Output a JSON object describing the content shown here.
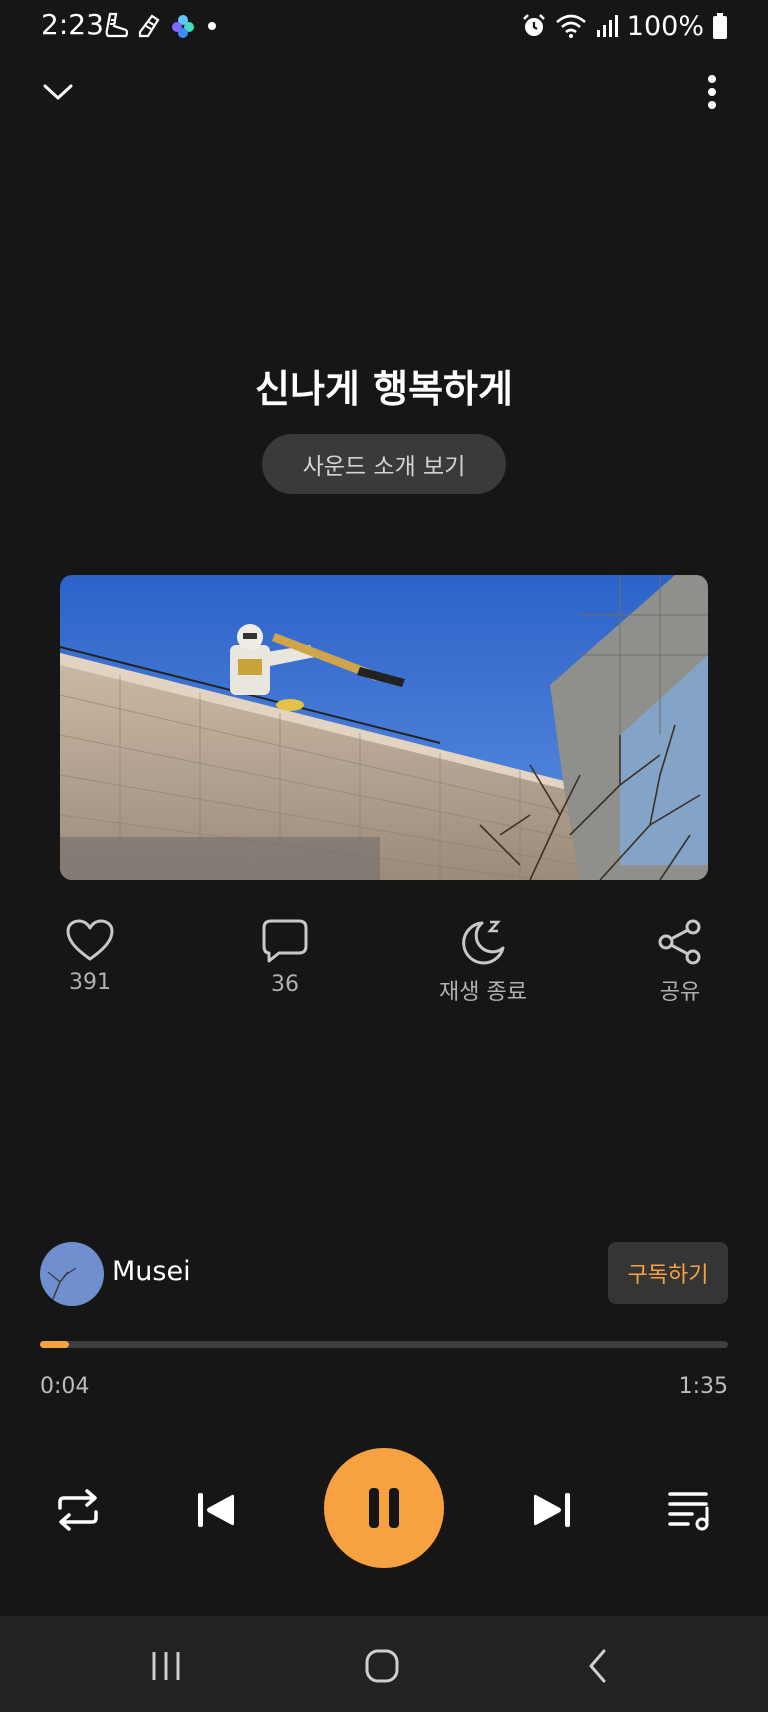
{
  "status_bar": {
    "time": "2:23",
    "battery": "100%",
    "left_icons": [
      "sneaker-icon",
      "sneaker-icon",
      "sparkle-app-icon",
      "dot-icon"
    ],
    "right_icons": [
      "alarm-icon",
      "wifi-icon",
      "signal-icon",
      "battery-icon"
    ]
  },
  "header": {
    "collapse_icon": "chevron-down-icon",
    "more_icon": "more-vertical-icon"
  },
  "track": {
    "title": "신나게 행복하게",
    "intro_button": "사운드 소개 보기",
    "artwork": "photo of a robot statue with a telescope on a building roof against blue sky"
  },
  "actions": [
    {
      "icon": "heart-icon",
      "label": "391"
    },
    {
      "icon": "comment-icon",
      "label": "36"
    },
    {
      "icon": "sleep-timer-icon",
      "label": "재생 종료"
    },
    {
      "icon": "share-icon",
      "label": "공유"
    }
  ],
  "artist": {
    "name": "Musei",
    "subscribe_label": "구독하기"
  },
  "progress": {
    "elapsed": "0:04",
    "total": "1:35",
    "fraction": 0.042
  },
  "controls": {
    "repeat_icon": "repeat-icon",
    "prev_icon": "skip-previous-icon",
    "play_icon": "pause-icon",
    "next_icon": "skip-next-icon",
    "queue_icon": "playlist-icon"
  },
  "colors": {
    "background": "#161616",
    "accent": "#f7a241",
    "button_bg": "#3a3a3a",
    "nav_bg": "#222222"
  }
}
